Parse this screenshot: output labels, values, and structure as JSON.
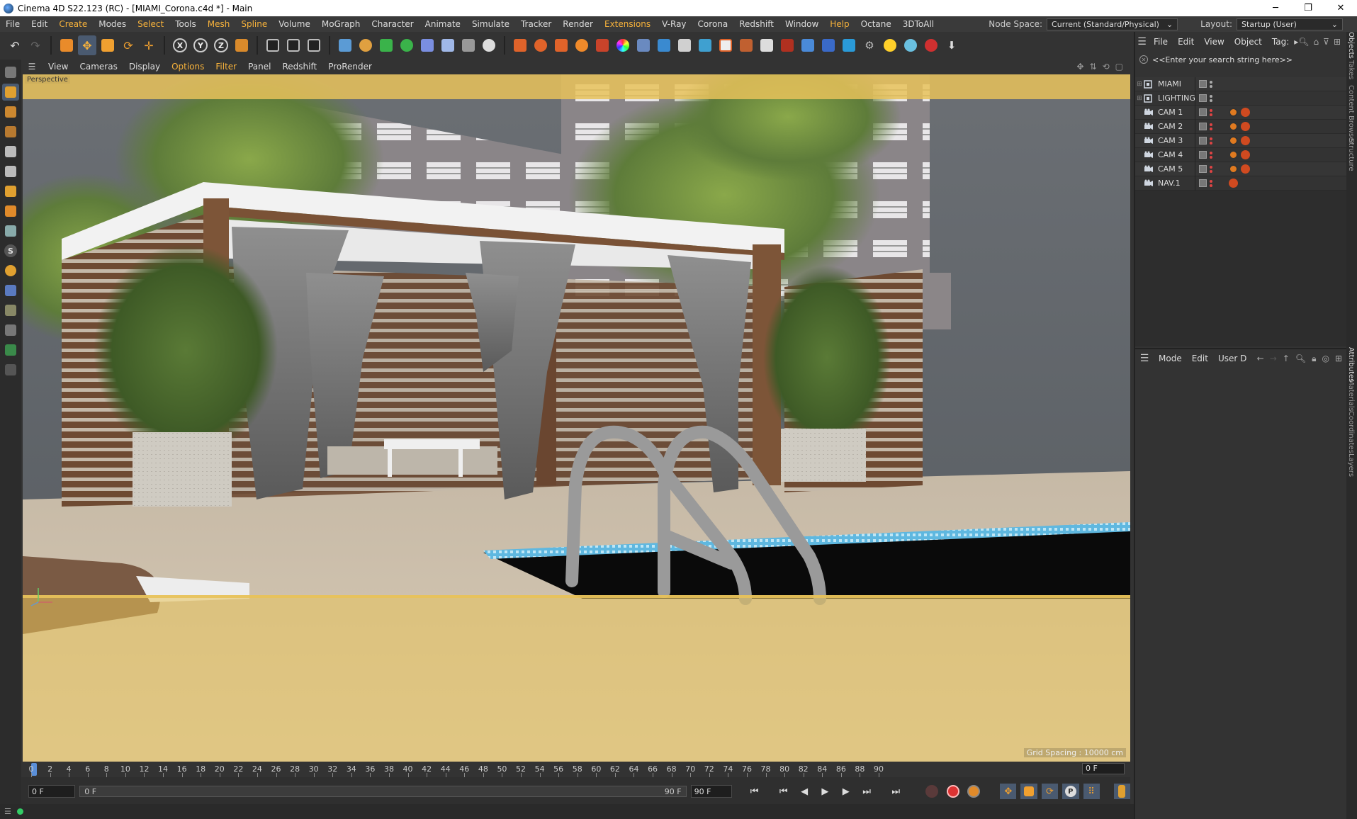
{
  "window": {
    "title": "Cinema 4D S22.123 (RC) - [MIAMI_Corona.c4d *] - Main",
    "minimize": "─",
    "restore": "❐",
    "close": "✕"
  },
  "menubar": {
    "items": [
      {
        "label": "File"
      },
      {
        "label": "Edit"
      },
      {
        "label": "Create",
        "highlight": true
      },
      {
        "label": "Modes"
      },
      {
        "label": "Select",
        "highlight": true
      },
      {
        "label": "Tools"
      },
      {
        "label": "Mesh",
        "highlight": true
      },
      {
        "label": "Spline",
        "highlight": true
      },
      {
        "label": "Volume"
      },
      {
        "label": "MoGraph"
      },
      {
        "label": "Character"
      },
      {
        "label": "Animate"
      },
      {
        "label": "Simulate"
      },
      {
        "label": "Tracker"
      },
      {
        "label": "Render"
      },
      {
        "label": "Extensions",
        "highlight": true
      },
      {
        "label": "V-Ray"
      },
      {
        "label": "Corona"
      },
      {
        "label": "Redshift"
      },
      {
        "label": "Window"
      },
      {
        "label": "Help",
        "highlight": true
      },
      {
        "label": "Octane"
      },
      {
        "label": "3DToAll"
      }
    ],
    "node_space_label": "Node Space:",
    "node_space_value": "Current (Standard/Physical)",
    "layout_label": "Layout:",
    "layout_value": "Startup (User)"
  },
  "viewport": {
    "menu": [
      {
        "label": "View"
      },
      {
        "label": "Cameras"
      },
      {
        "label": "Display"
      },
      {
        "label": "Options",
        "highlight": true
      },
      {
        "label": "Filter",
        "highlight": true
      },
      {
        "label": "Panel"
      },
      {
        "label": "Redshift"
      },
      {
        "label": "ProRender"
      }
    ],
    "camera_label": "Perspective",
    "grid_spacing": "Grid Spacing : 10000 cm"
  },
  "timeline": {
    "ticks": [
      "0",
      "2",
      "4",
      "6",
      "8",
      "10",
      "12",
      "14",
      "16",
      "18",
      "20",
      "22",
      "24",
      "26",
      "28",
      "30",
      "32",
      "34",
      "36",
      "38",
      "40",
      "42",
      "44",
      "46",
      "48",
      "50",
      "52",
      "54",
      "56",
      "58",
      "60",
      "62",
      "64",
      "66",
      "68",
      "70",
      "72",
      "74",
      "76",
      "78",
      "80",
      "82",
      "84",
      "86",
      "88",
      "90"
    ],
    "current_frame_display": "0 F",
    "start_field": "0 F",
    "range_start": "0 F",
    "range_end": "90 F",
    "end_field": "90 F"
  },
  "objects_panel": {
    "menu": [
      {
        "label": "File"
      },
      {
        "label": "Edit"
      },
      {
        "label": "View"
      },
      {
        "label": "Object"
      },
      {
        "label": "Tag:"
      }
    ],
    "search_placeholder": "<<Enter your search string here>>",
    "objects": [
      {
        "name": "MIAMI",
        "type": "layer-null",
        "tags": []
      },
      {
        "name": "LIGHTING",
        "type": "layer-null",
        "tags": []
      },
      {
        "name": "CAM 1",
        "type": "camera",
        "tags": [
          "protection-tag",
          "corona-camera-tag"
        ]
      },
      {
        "name": "CAM 2",
        "type": "camera",
        "tags": [
          "protection-tag",
          "corona-camera-tag"
        ]
      },
      {
        "name": "CAM 3",
        "type": "camera",
        "tags": [
          "protection-tag",
          "corona-camera-tag"
        ]
      },
      {
        "name": "CAM 4",
        "type": "camera",
        "tags": [
          "protection-tag",
          "corona-camera-tag"
        ]
      },
      {
        "name": "CAM 5",
        "type": "camera",
        "tags": [
          "protection-tag",
          "corona-camera-tag"
        ]
      },
      {
        "name": "NAV.1",
        "type": "camera",
        "tags": [
          "corona-camera-tag"
        ]
      }
    ]
  },
  "attributes_panel": {
    "menu": [
      {
        "label": "Mode"
      },
      {
        "label": "Edit"
      },
      {
        "label": "User D"
      }
    ]
  },
  "side_tabs": [
    "Objects",
    "Takes",
    "Content Browser",
    "Structure",
    "Attributes",
    "Materials",
    "Coordinates",
    "Layers"
  ],
  "colors": {
    "accent": "#f7b23b",
    "panel_bg": "#333333",
    "playhead": "#5a8fd8",
    "safe_frame": "#e8c25a"
  }
}
